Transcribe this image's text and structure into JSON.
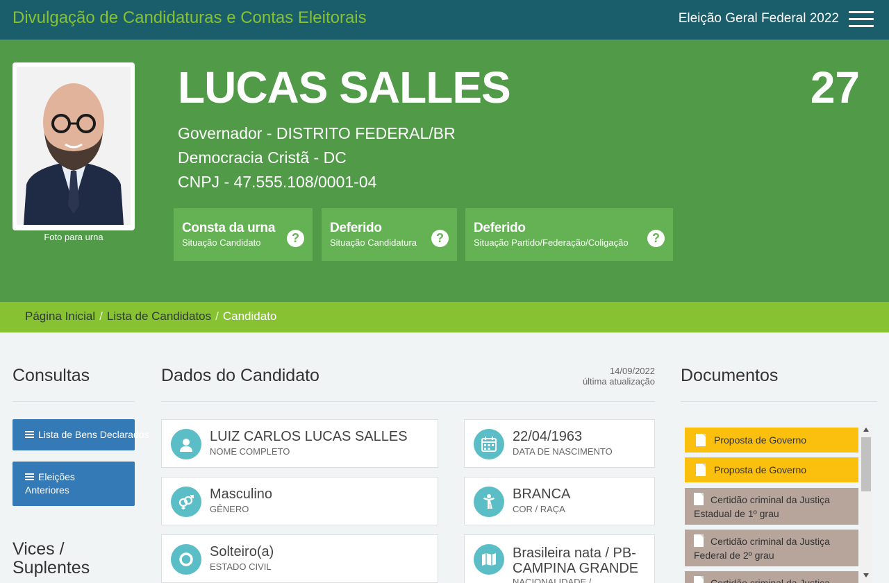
{
  "header": {
    "brand": "Divulgação de Candidaturas e Contas Eleitorais",
    "election": "Eleição Geral Federal 2022",
    "menu_icon": "hamburger-menu-icon"
  },
  "candidate": {
    "name": "LUCAS SALLES",
    "number": "27",
    "office": "Governador - DISTRITO FEDERAL/BR",
    "party": "Democracia Cristã - DC",
    "cnpj": "CNPJ - 47.555.108/0001-04",
    "photo_caption": "Foto para urna"
  },
  "statuses": [
    {
      "main": "Consta da urna",
      "sub": "Situação Candidato"
    },
    {
      "main": "Deferido",
      "sub": "Situação Candidatura"
    },
    {
      "main": "Deferido",
      "sub": "Situação Partido/Federação/Coligação"
    }
  ],
  "breadcrumb": {
    "home": "Página Inicial",
    "list": "Lista de Candidatos",
    "current": "Candidato"
  },
  "left": {
    "title": "Consultas",
    "btn_assets": "Lista de Bens Declarados",
    "btn_prev_line1": "Eleições",
    "btn_prev_line2": "Anteriores",
    "vices_line1": "Vices /",
    "vices_line2": "Suplentes"
  },
  "center": {
    "title": "Dados do Candidato",
    "update_date": "14/09/2022",
    "update_label": "última atualização",
    "cards": {
      "full_name": {
        "value": "LUIZ CARLOS LUCAS SALLES",
        "label": "NOME COMPLETO"
      },
      "birth": {
        "value": "22/04/1963",
        "label": "DATA DE NASCIMENTO"
      },
      "gender": {
        "value": "Masculino",
        "label": "GÊNERO"
      },
      "race": {
        "value": "BRANCA",
        "label": "COR / RAÇA"
      },
      "civil": {
        "value": "Solteiro(a)",
        "label": "ESTADO CIVIL"
      },
      "nationality": {
        "value_line1": "Brasileira nata / PB-",
        "value_line2": "CAMPINA GRANDE",
        "label": "NACIONALIDADE /"
      }
    }
  },
  "documents": {
    "title": "Documentos",
    "items": [
      {
        "label": "Proposta de Governo",
        "kind": "yellow"
      },
      {
        "label": "Proposta de Governo",
        "kind": "yellow"
      },
      {
        "line1": "Certidão criminal da Justiça",
        "line2": "Estadual de 1º grau",
        "kind": "grey"
      },
      {
        "line1": "Certidão criminal da Justiça",
        "line2": "Federal de 2º grau",
        "kind": "grey"
      },
      {
        "line1": "Certidão criminal da Justiça",
        "kind": "grey"
      }
    ]
  },
  "colors": {
    "topbar": "#1b5e6b",
    "brand_green": "#86c232",
    "hero": "#509a48",
    "status_box": "#65b255",
    "button_blue": "#337ab7",
    "icon_teal": "#5bbec7",
    "doc_yellow": "#fbc00e",
    "doc_grey": "#b7a59c"
  }
}
